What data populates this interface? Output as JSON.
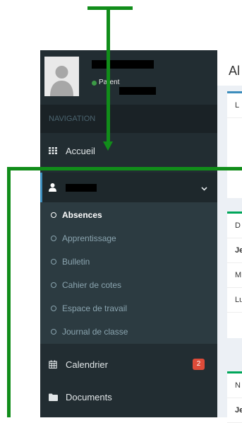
{
  "header": {
    "partial_text": ""
  },
  "user_panel": {
    "status": "Parent"
  },
  "sidebar": {
    "nav_header": "NAVIGATION",
    "accueil": "Accueil",
    "submenu": [
      "Absences",
      "Apprentissage",
      "Bulletin",
      "Cahier de cotes",
      "Espace de travail",
      "Journal de classe"
    ],
    "calendrier": "Calendrier",
    "calendrier_badge": "2",
    "documents": "Documents"
  },
  "content": {
    "title_partial": "Al",
    "box1": [
      "L"
    ],
    "box2": [
      "D",
      "Je",
      "M",
      "Lu"
    ],
    "box3": [
      "N",
      "Je"
    ]
  },
  "colors": {
    "sidebar": "#222d32",
    "accent": "#3c8dbc",
    "annotation": "#118d1a",
    "badge": "#dd4b39"
  }
}
